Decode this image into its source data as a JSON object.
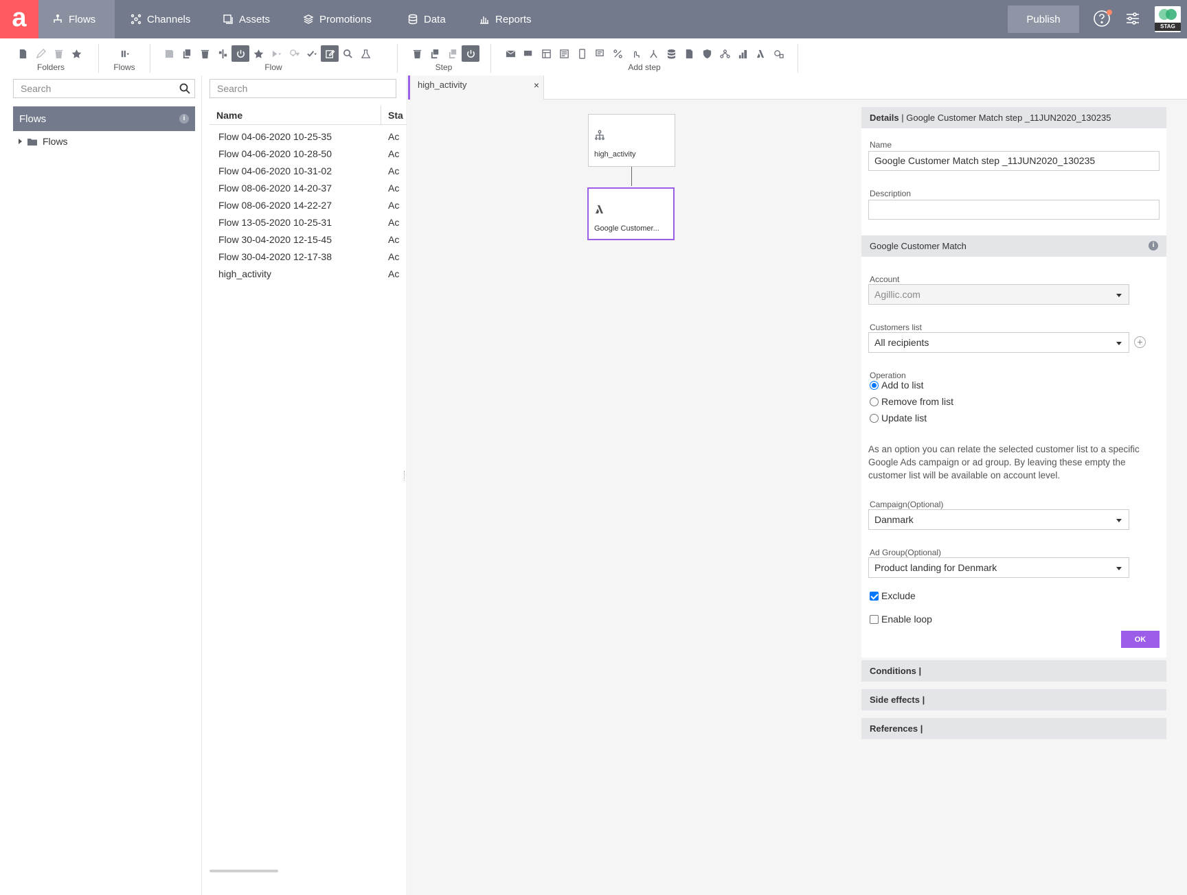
{
  "nav": {
    "logo_letter": "a",
    "tabs": [
      {
        "label": "Flows",
        "icon": "flows-icon"
      },
      {
        "label": "Channels",
        "icon": "channels-icon"
      },
      {
        "label": "Assets",
        "icon": "assets-icon"
      },
      {
        "label": "Promotions",
        "icon": "promotions-icon"
      },
      {
        "label": "Data",
        "icon": "data-icon"
      },
      {
        "label": "Reports",
        "icon": "reports-icon"
      }
    ],
    "publish_label": "Publish",
    "env_badge": "STAG",
    "colors": {
      "bar": "#737a8c",
      "active_tab": "#8a90a0",
      "logo": "#ff5a5f",
      "accent": "#9c5ee8"
    }
  },
  "toolbar": {
    "groups": [
      {
        "label": "Folders"
      },
      {
        "label": "Flows"
      },
      {
        "label": "Flow"
      },
      {
        "label": "Step"
      },
      {
        "label": "Add step"
      }
    ]
  },
  "left_panel": {
    "search_placeholder": "Search",
    "header": "Flows",
    "tree": [
      {
        "label": "Flows"
      }
    ]
  },
  "list_panel": {
    "search_placeholder": "Search",
    "columns": [
      "Name",
      "Sta"
    ],
    "rows": [
      {
        "name": "Flow 04-06-2020 10-25-35",
        "status": "Ac"
      },
      {
        "name": "Flow 04-06-2020 10-28-50",
        "status": "Ac"
      },
      {
        "name": "Flow 04-06-2020 10-31-02",
        "status": "Ac"
      },
      {
        "name": "Flow 08-06-2020 14-20-37",
        "status": "Ac"
      },
      {
        "name": "Flow 08-06-2020 14-22-27",
        "status": "Ac"
      },
      {
        "name": "Flow 13-05-2020 10-25-31",
        "status": "Ac"
      },
      {
        "name": "Flow 30-04-2020 12-15-45",
        "status": "Ac"
      },
      {
        "name": "Flow 30-04-2020 12-17-38",
        "status": "Ac"
      },
      {
        "name": "high_activity",
        "status": "Ac"
      }
    ]
  },
  "canvas": {
    "tab_label": "high_activity",
    "tab_close": "×",
    "nodes": [
      {
        "label": "high_activity",
        "icon": "flow-tree-icon"
      },
      {
        "label": "Google Customer...",
        "icon": "google-ads-icon"
      }
    ]
  },
  "details": {
    "header_bold": "Details",
    "header_rest": " | Google Customer Match step _11JUN2020_130235",
    "name_label": "Name",
    "name_value": "Google Customer Match step _11JUN2020_130235",
    "description_label": "Description",
    "description_value": "",
    "gcm_header": "Google Customer Match",
    "account_label": "Account",
    "account_value": "Agillic.com",
    "customers_list_label": "Customers list",
    "customers_list_value": "All recipients",
    "operation_label": "Operation",
    "operations": [
      {
        "label": "Add to list",
        "selected": true
      },
      {
        "label": "Remove from list",
        "selected": false
      },
      {
        "label": "Update list",
        "selected": false
      }
    ],
    "help_text": "As an option you can relate the selected customer list to a specific Google Ads campaign or ad group. By leaving these empty the customer list will be available on account level.",
    "campaign_label": "Campaign(Optional)",
    "campaign_value": "Danmark",
    "adgroup_label": "Ad Group(Optional)",
    "adgroup_value": "Product landing for Denmark",
    "exclude_label": "Exclude",
    "exclude_checked": true,
    "loop_label": "Enable loop",
    "loop_checked": false,
    "ok_label": "OK",
    "sections": [
      {
        "label": "Conditions |"
      },
      {
        "label": "Side effects |"
      },
      {
        "label": "References |"
      }
    ]
  }
}
